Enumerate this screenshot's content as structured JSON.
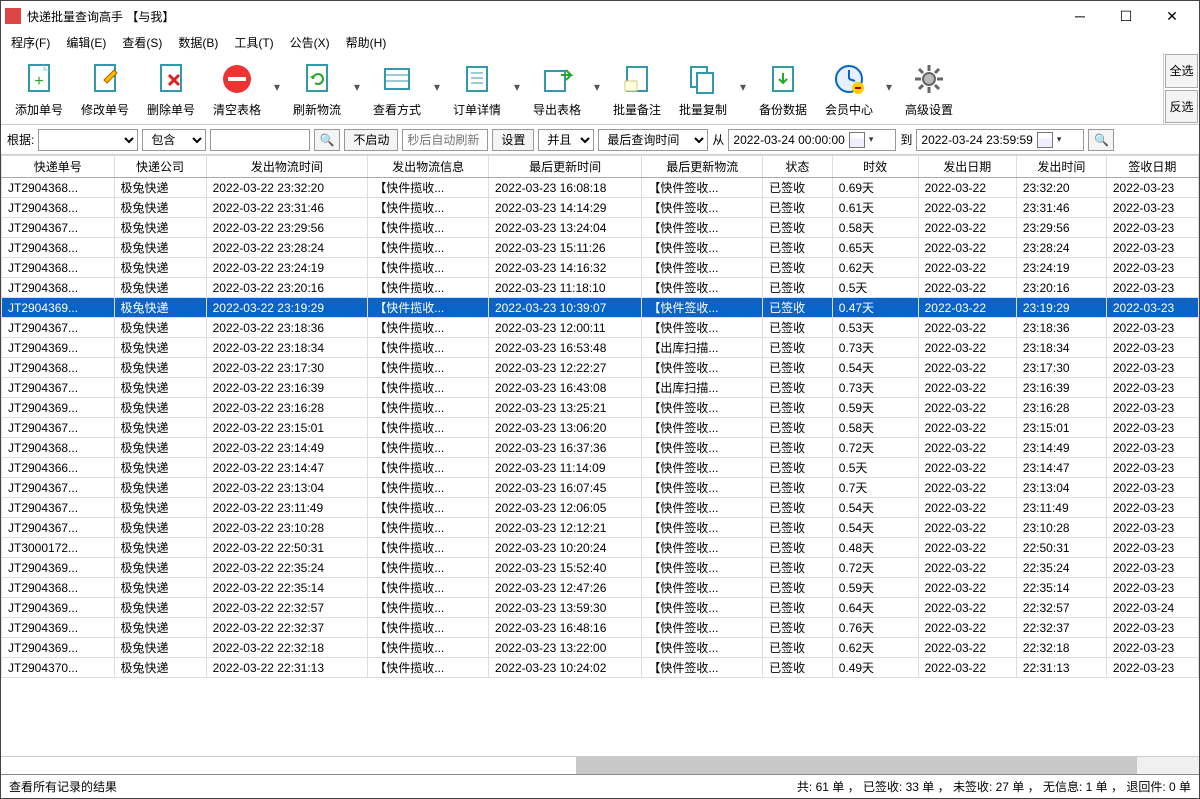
{
  "window": {
    "title": "快递批量查询高手 【与我】"
  },
  "menu": {
    "items": [
      "程序(F)",
      "编辑(E)",
      "查看(S)",
      "数据(B)",
      "工具(T)",
      "公告(X)",
      "帮助(H)"
    ]
  },
  "toolbar": {
    "buttons": [
      {
        "label": "添加单号",
        "icon": "doc-plus"
      },
      {
        "label": "修改单号",
        "icon": "doc-edit"
      },
      {
        "label": "删除单号",
        "icon": "doc-del"
      },
      {
        "label": "清空表格",
        "icon": "clear"
      },
      {
        "label": "刷新物流",
        "icon": "refresh"
      },
      {
        "label": "查看方式",
        "icon": "view"
      },
      {
        "label": "订单详情",
        "icon": "detail"
      },
      {
        "label": "导出表格",
        "icon": "export"
      },
      {
        "label": "批量备注",
        "icon": "note"
      },
      {
        "label": "批量复制",
        "icon": "copy"
      },
      {
        "label": "备份数据",
        "icon": "backup"
      },
      {
        "label": "会员中心",
        "icon": "clock"
      },
      {
        "label": "高级设置",
        "icon": "gear"
      }
    ],
    "side": {
      "select_all": "全选",
      "invert": "反选"
    }
  },
  "filter": {
    "root_label": "根据:",
    "contains": "包含",
    "no_start": "不启动",
    "auto_refresh_placeholder": "秒后自动刷新",
    "settings": "设置",
    "and": "并且",
    "last_query_time": "最后查询时间",
    "from": "从",
    "to": "到",
    "date_from": "2022-03-24 00:00:00",
    "date_to": "2022-03-24 23:59:59"
  },
  "columns": [
    "快递单号",
    "快递公司",
    "发出物流时间",
    "发出物流信息",
    "最后更新时间",
    "最后更新物流",
    "状态",
    "时效",
    "发出日期",
    "发出时间",
    "签收日期"
  ],
  "rows": [
    {
      "c": [
        "JT2904368...",
        "极兔快递",
        "2022-03-22 23:32:20",
        "【快件揽收...",
        "2022-03-23 16:08:18",
        "【快件签收...",
        "已签收",
        "0.69天",
        "2022-03-22",
        "23:32:20",
        "2022-03-23"
      ]
    },
    {
      "c": [
        "JT2904368...",
        "极兔快递",
        "2022-03-22 23:31:46",
        "【快件揽收...",
        "2022-03-23 14:14:29",
        "【快件签收...",
        "已签收",
        "0.61天",
        "2022-03-22",
        "23:31:46",
        "2022-03-23"
      ]
    },
    {
      "c": [
        "JT2904367...",
        "极兔快递",
        "2022-03-22 23:29:56",
        "【快件揽收...",
        "2022-03-23 13:24:04",
        "【快件签收...",
        "已签收",
        "0.58天",
        "2022-03-22",
        "23:29:56",
        "2022-03-23"
      ]
    },
    {
      "c": [
        "JT2904368...",
        "极兔快递",
        "2022-03-22 23:28:24",
        "【快件揽收...",
        "2022-03-23 15:11:26",
        "【快件签收...",
        "已签收",
        "0.65天",
        "2022-03-22",
        "23:28:24",
        "2022-03-23"
      ]
    },
    {
      "c": [
        "JT2904368...",
        "极兔快递",
        "2022-03-22 23:24:19",
        "【快件揽收...",
        "2022-03-23 14:16:32",
        "【快件签收...",
        "已签收",
        "0.62天",
        "2022-03-22",
        "23:24:19",
        "2022-03-23"
      ]
    },
    {
      "c": [
        "JT2904368...",
        "极兔快递",
        "2022-03-22 23:20:16",
        "【快件揽收...",
        "2022-03-23 11:18:10",
        "【快件签收...",
        "已签收",
        "0.5天",
        "2022-03-22",
        "23:20:16",
        "2022-03-23"
      ]
    },
    {
      "c": [
        "JT2904369...",
        "极兔快递",
        "2022-03-22 23:19:29",
        "【快件揽收...",
        "2022-03-23 10:39:07",
        "【快件签收...",
        "已签收",
        "0.47天",
        "2022-03-22",
        "23:19:29",
        "2022-03-23"
      ],
      "sel": true
    },
    {
      "c": [
        "JT2904367...",
        "极兔快递",
        "2022-03-22 23:18:36",
        "【快件揽收...",
        "2022-03-23 12:00:11",
        "【快件签收...",
        "已签收",
        "0.53天",
        "2022-03-22",
        "23:18:36",
        "2022-03-23"
      ]
    },
    {
      "c": [
        "JT2904369...",
        "极兔快递",
        "2022-03-22 23:18:34",
        "【快件揽收...",
        "2022-03-23 16:53:48",
        "【出库扫描...",
        "已签收",
        "0.73天",
        "2022-03-22",
        "23:18:34",
        "2022-03-23"
      ]
    },
    {
      "c": [
        "JT2904368...",
        "极兔快递",
        "2022-03-22 23:17:30",
        "【快件揽收...",
        "2022-03-23 12:22:27",
        "【快件签收...",
        "已签收",
        "0.54天",
        "2022-03-22",
        "23:17:30",
        "2022-03-23"
      ]
    },
    {
      "c": [
        "JT2904367...",
        "极兔快递",
        "2022-03-22 23:16:39",
        "【快件揽收...",
        "2022-03-23 16:43:08",
        "【出库扫描...",
        "已签收",
        "0.73天",
        "2022-03-22",
        "23:16:39",
        "2022-03-23"
      ]
    },
    {
      "c": [
        "JT2904369...",
        "极兔快递",
        "2022-03-22 23:16:28",
        "【快件揽收...",
        "2022-03-23 13:25:21",
        "【快件签收...",
        "已签收",
        "0.59天",
        "2022-03-22",
        "23:16:28",
        "2022-03-23"
      ]
    },
    {
      "c": [
        "JT2904367...",
        "极兔快递",
        "2022-03-22 23:15:01",
        "【快件揽收...",
        "2022-03-23 13:06:20",
        "【快件签收...",
        "已签收",
        "0.58天",
        "2022-03-22",
        "23:15:01",
        "2022-03-23"
      ]
    },
    {
      "c": [
        "JT2904368...",
        "极兔快递",
        "2022-03-22 23:14:49",
        "【快件揽收...",
        "2022-03-23 16:37:36",
        "【快件签收...",
        "已签收",
        "0.72天",
        "2022-03-22",
        "23:14:49",
        "2022-03-23"
      ]
    },
    {
      "c": [
        "JT2904366...",
        "极兔快递",
        "2022-03-22 23:14:47",
        "【快件揽收...",
        "2022-03-23 11:14:09",
        "【快件签收...",
        "已签收",
        "0.5天",
        "2022-03-22",
        "23:14:47",
        "2022-03-23"
      ]
    },
    {
      "c": [
        "JT2904367...",
        "极兔快递",
        "2022-03-22 23:13:04",
        "【快件揽收...",
        "2022-03-23 16:07:45",
        "【快件签收...",
        "已签收",
        "0.7天",
        "2022-03-22",
        "23:13:04",
        "2022-03-23"
      ]
    },
    {
      "c": [
        "JT2904367...",
        "极兔快递",
        "2022-03-22 23:11:49",
        "【快件揽收...",
        "2022-03-23 12:06:05",
        "【快件签收...",
        "已签收",
        "0.54天",
        "2022-03-22",
        "23:11:49",
        "2022-03-23"
      ]
    },
    {
      "c": [
        "JT2904367...",
        "极兔快递",
        "2022-03-22 23:10:28",
        "【快件揽收...",
        "2022-03-23 12:12:21",
        "【快件签收...",
        "已签收",
        "0.54天",
        "2022-03-22",
        "23:10:28",
        "2022-03-23"
      ]
    },
    {
      "c": [
        "JT3000172...",
        "极兔快递",
        "2022-03-22 22:50:31",
        "【快件揽收...",
        "2022-03-23 10:20:24",
        "【快件签收...",
        "已签收",
        "0.48天",
        "2022-03-22",
        "22:50:31",
        "2022-03-23"
      ]
    },
    {
      "c": [
        "JT2904369...",
        "极兔快递",
        "2022-03-22 22:35:24",
        "【快件揽收...",
        "2022-03-23 15:52:40",
        "【快件签收...",
        "已签收",
        "0.72天",
        "2022-03-22",
        "22:35:24",
        "2022-03-23"
      ]
    },
    {
      "c": [
        "JT2904368...",
        "极兔快递",
        "2022-03-22 22:35:14",
        "【快件揽收...",
        "2022-03-23 12:47:26",
        "【快件签收...",
        "已签收",
        "0.59天",
        "2022-03-22",
        "22:35:14",
        "2022-03-23"
      ]
    },
    {
      "c": [
        "JT2904369...",
        "极兔快递",
        "2022-03-22 22:32:57",
        "【快件揽收...",
        "2022-03-23 13:59:30",
        "【快件签收...",
        "已签收",
        "0.64天",
        "2022-03-22",
        "22:32:57",
        "2022-03-24"
      ]
    },
    {
      "c": [
        "JT2904369...",
        "极兔快递",
        "2022-03-22 22:32:37",
        "【快件揽收...",
        "2022-03-23 16:48:16",
        "【快件签收...",
        "已签收",
        "0.76天",
        "2022-03-22",
        "22:32:37",
        "2022-03-23"
      ]
    },
    {
      "c": [
        "JT2904369...",
        "极兔快递",
        "2022-03-22 22:32:18",
        "【快件揽收...",
        "2022-03-23 13:22:00",
        "【快件签收...",
        "已签收",
        "0.62天",
        "2022-03-22",
        "22:32:18",
        "2022-03-23"
      ]
    },
    {
      "c": [
        "JT2904370...",
        "极兔快递",
        "2022-03-22 22:31:13",
        "【快件揽收...",
        "2022-03-23 10:24:02",
        "【快件签收...",
        "已签收",
        "0.49天",
        "2022-03-22",
        "22:31:13",
        "2022-03-23"
      ]
    }
  ],
  "status": {
    "left": "查看所有记录的结果",
    "right": "共: 61 单 ， 已签收:   33 单 ， 未签收:   27 单 ， 无信息: 1 单 ， 退回件: 0 单"
  }
}
